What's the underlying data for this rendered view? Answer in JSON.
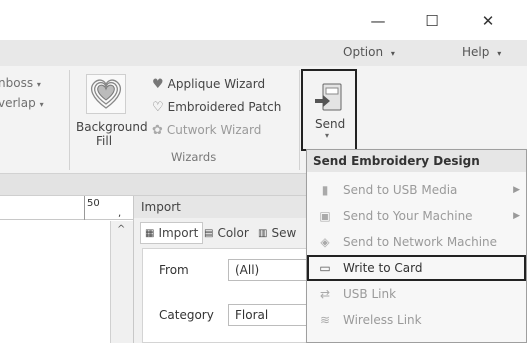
{
  "window": {
    "minimize": "—",
    "maximize": "☐",
    "close": "✕"
  },
  "menu": {
    "option": "Option",
    "help": "Help"
  },
  "ribbon": {
    "emboss": "nboss",
    "overlap": "verlap",
    "background_fill_1": "Background",
    "background_fill_2": "Fill",
    "applique_wizard": "Applique Wizard",
    "embroidered_patch": "Embroidered Patch",
    "cutwork_wizard": "Cutwork Wizard",
    "wizards_group": "Wizards",
    "send": "Send"
  },
  "ruler": {
    "tick_label": "50"
  },
  "import_panel": {
    "title": "Import",
    "tabs": [
      "Import",
      "Color",
      "Sew"
    ],
    "from_label": "From",
    "from_value": "(All)",
    "category_label": "Category",
    "category_value": "Floral"
  },
  "send_menu": {
    "header": "Send Embroidery Design",
    "items": [
      {
        "label": "Send to USB Media",
        "submenu": true,
        "enabled": false
      },
      {
        "label": "Send to Your Machine",
        "submenu": true,
        "enabled": false
      },
      {
        "label": "Send to Network Machine",
        "submenu": false,
        "enabled": false
      },
      {
        "label": "Write to Card",
        "submenu": false,
        "enabled": true
      },
      {
        "label": "USB Link",
        "submenu": false,
        "enabled": false
      },
      {
        "label": "Wireless Link",
        "submenu": false,
        "enabled": false
      }
    ]
  },
  "colors": {
    "ribbon_bg": "#f3f3f3",
    "menu_bg": "#e8e8e8",
    "highlight_border": "#222222",
    "disabled_text": "#9a9a9a"
  }
}
